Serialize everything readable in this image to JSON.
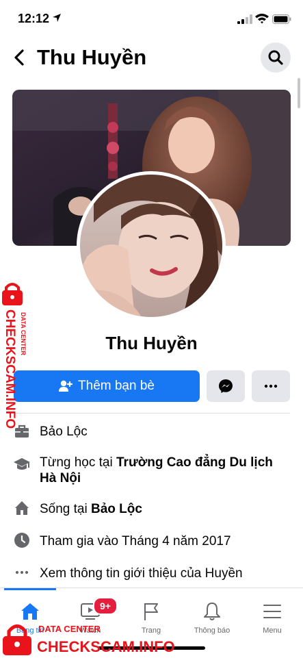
{
  "status_bar": {
    "time": "12:12"
  },
  "header": {
    "title": "Thu Huyền"
  },
  "profile": {
    "name": "Thu Huyền",
    "add_friend_label": "Thêm bạn bè"
  },
  "info": [
    {
      "icon": "briefcase-icon",
      "text": "Bảo Lộc"
    },
    {
      "icon": "graduation-cap-icon",
      "prefix": "Từng học tại ",
      "bold": "Trường Cao đẳng Du lịch Hà Nội"
    },
    {
      "icon": "house-icon",
      "prefix": "Sống tại ",
      "bold": "Bảo Lộc"
    },
    {
      "icon": "clock-icon",
      "text": "Tham gia vào Tháng 4 năm 2017"
    },
    {
      "icon": "more-dots-icon",
      "text": "Xem thông tin giới thiệu của Huyền"
    }
  ],
  "tabs": [
    {
      "label": "Bảng tin",
      "icon": "home-icon",
      "active": true
    },
    {
      "label": "Watch",
      "icon": "watch-icon",
      "badge": "9+"
    },
    {
      "label": "Trang",
      "icon": "flag-icon"
    },
    {
      "label": "Thông báo",
      "icon": "bell-icon"
    },
    {
      "label": "Menu",
      "icon": "menu-icon"
    }
  ],
  "watermark": {
    "side_text": "CHECKSCAM.INFO",
    "side_subtext": "DATA CENTER",
    "bottom_text": "CHECKSCAM.INFO",
    "bottom_subtext": "DATA CENTER"
  },
  "colors": {
    "accent": "#1877f2",
    "badge": "#e41e3f",
    "watermark": "#e8131b"
  }
}
